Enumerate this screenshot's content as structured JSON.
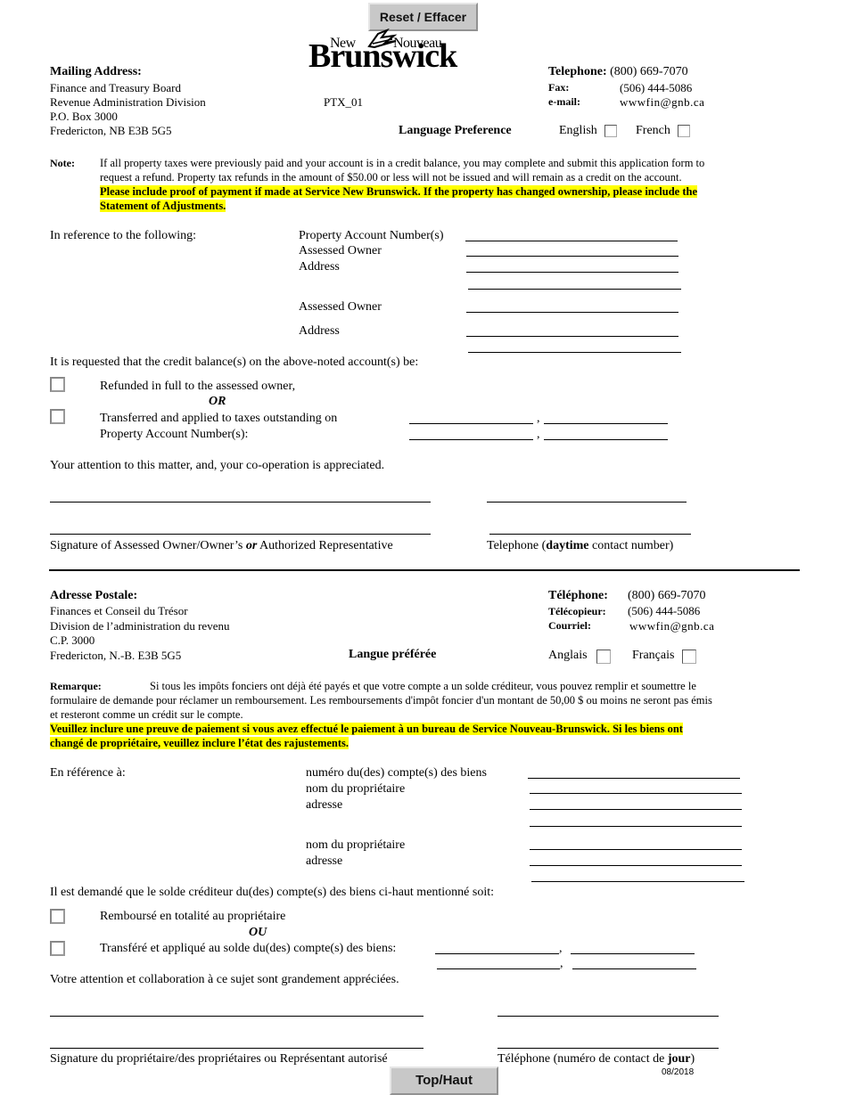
{
  "buttons": {
    "reset": "Reset / Effacer",
    "top": "Top/Haut"
  },
  "logo": {
    "new": "New",
    "nouveau": "Nouveau",
    "brunswick": "Brunswick"
  },
  "form_code": "PTX_01",
  "form_date": "08/2018",
  "english": {
    "mailing": {
      "heading": "Mailing Address:",
      "lines": [
        "Finance and Treasury Board",
        "Revenue Administration Division",
        "P.O. Box 3000",
        "Fredericton, NB  E3B 5G5"
      ]
    },
    "contact": {
      "telephone_label": "Telephone:",
      "telephone": "(800) 669-7070",
      "fax_label": "Fax:",
      "fax": "(506) 444-5086",
      "email_label": "e-mail:",
      "email": "wwwfin@gnb.ca"
    },
    "language": {
      "label": "Language Preference",
      "option1": "English",
      "option2": "French"
    },
    "note": {
      "label": "Note:",
      "line1": "If all property taxes were previously paid and your account is in a credit balance, you may complete and submit this application form to",
      "line2": "request a refund.  Property tax refunds in the amount of $50.00 or less will not be issued and will remain as a credit on the account.",
      "highlight1": "Please include proof of payment if made at Service New Brunswick. If the property has changed ownership, please include the",
      "highlight2": "Statement of Adjustments."
    },
    "reference": {
      "label": "In reference to the following:",
      "fields": [
        "Property Account Number(s)",
        "Assessed Owner",
        "Address",
        "Assessed Owner",
        "Address"
      ]
    },
    "request": "It is requested that the credit balance(s) on the above-noted account(s) be:",
    "option_refund": "Refunded in full to the assessed owner,",
    "or": "OR",
    "option_transfer1": "Transferred and applied to taxes outstanding on",
    "option_transfer2": "Property Account Number(s):",
    "appreciation": "Your attention to this matter, and, your co-operation is appreciated.",
    "signature_pre": "Signature of Assessed Owner/Owner’s ",
    "signature_or": "or",
    "signature_post": " Authorized Representative",
    "phone_pre": "Telephone (",
    "phone_bold": "daytime",
    "phone_post": " contact number)"
  },
  "french": {
    "mailing": {
      "heading": "Adresse Postale:",
      "lines": [
        "Finances  et Conseil du Trésor",
        "Division de l’administration du revenu",
        "C.P. 3000",
        "Fredericton, N.-B.  E3B 5G5"
      ]
    },
    "contact": {
      "telephone_label": "Téléphone:",
      "telephone": "(800) 669-7070",
      "fax_label": "Télécopieur:",
      "fax": "(506) 444-5086",
      "email_label": "Courriel:",
      "email": "wwwfin@gnb.ca"
    },
    "language": {
      "label": "Langue préférée",
      "option1": "Anglais",
      "option2": "Français"
    },
    "note": {
      "label": "Remarque:",
      "line1": "Si tous les impôts fonciers ont déjà été payés et que votre compte a un solde créditeur, vous pouvez remplir et soumettre le",
      "line2": "formulaire de demande pour réclamer un remboursement. Les remboursements d'impôt foncier d'un montant de 50,00 $ ou moins ne seront pas émis",
      "line3": "et resteront comme un crédit sur le compte.",
      "highlight1": "Veuillez inclure une preuve de paiement si vous avez effectué le paiement à un bureau de Service Nouveau-Brunswick. Si les biens ont",
      "highlight2": "changé de propriétaire, veuillez inclure l’état des rajustements."
    },
    "reference": {
      "label": "En référence à:",
      "fields": [
        "numéro du(des) compte(s) des biens",
        "nom du propriétaire",
        "adresse",
        "nom du propriétaire",
        "adresse"
      ]
    },
    "request": "Il est demandé que le solde créditeur du(des) compte(s) des biens ci-haut mentionné soit:",
    "option_refund": "Remboursé en totalité au propriétaire",
    "or": "OU",
    "option_transfer1": "Transféré et appliqué au solde du(des) compte(s) des biens:",
    "appreciation": "Votre attention et collaboration à ce sujet sont grandement appréciées.",
    "signature": "Signature du propriétaire/des propriétaires ou Représentant autorisé",
    "phone_pre": "Téléphone (numéro de contact de ",
    "phone_bold": "jour",
    "phone_post": ")"
  }
}
